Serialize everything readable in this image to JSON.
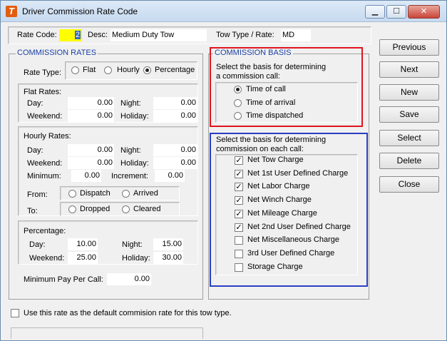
{
  "window": {
    "title": "Driver Commission Rate Code"
  },
  "header": {
    "rate_code_label": "Rate Code:",
    "rate_code_value": "2",
    "desc_label": "Desc:",
    "desc_value": "Medium Duty Tow",
    "tow_type_label": "Tow Type / Rate:",
    "tow_type_value": "MD"
  },
  "commission_rates": {
    "title": "COMMISSION RATES",
    "rate_type_label": "Rate Type:",
    "rate_type_options": [
      "Flat",
      "Hourly",
      "Percentage"
    ],
    "rate_type_selected": "Percentage",
    "flat": {
      "title": "Flat Rates:",
      "day_label": "Day:",
      "day": "0.00",
      "night_label": "Night:",
      "night": "0.00",
      "weekend_label": "Weekend:",
      "weekend": "0.00",
      "holiday_label": "Holiday:",
      "holiday": "0.00"
    },
    "hourly": {
      "title": "Hourly Rates:",
      "day_label": "Day:",
      "day": "0.00",
      "night_label": "Night:",
      "night": "0.00",
      "weekend_label": "Weekend:",
      "weekend": "0.00",
      "holiday_label": "Holiday:",
      "holiday": "0.00",
      "minimum_label": "Minimum:",
      "minimum": "0.00",
      "increment_label": "Increment:",
      "increment": "0.00",
      "from_label": "From:",
      "from_options": [
        "Dispatch",
        "Arrived"
      ],
      "to_label": "To:",
      "to_options": [
        "Dropped",
        "Cleared"
      ]
    },
    "percentage": {
      "title": "Percentage:",
      "day_label": "Day:",
      "day": "10.00",
      "night_label": "Night:",
      "night": "15.00",
      "weekend_label": "Weekend:",
      "weekend": "25.00",
      "holiday_label": "Holiday:",
      "holiday": "30.00"
    },
    "min_pay_label": "Minimum Pay Per Call:",
    "min_pay_value": "0.00"
  },
  "commission_basis": {
    "title": "COMMISSION BASIS",
    "basis_prompt_line1": "Select the basis for determining",
    "basis_prompt_line2": "a commission call:",
    "basis_options": [
      "Time of call",
      "Time of arrival",
      "Time dispatched"
    ],
    "basis_selected": "Time of call",
    "charges_prompt_line1": "Select the basis for determining",
    "charges_prompt_line2": "commission on each call:",
    "charges": [
      {
        "label": "Net Tow Charge",
        "checked": true
      },
      {
        "label": "Net 1st User Defined Charge",
        "checked": true
      },
      {
        "label": "Net Labor Charge",
        "checked": true
      },
      {
        "label": "Net Winch Charge",
        "checked": true
      },
      {
        "label": "Net Mileage Charge",
        "checked": true
      },
      {
        "label": "Net 2nd User Defined Charge",
        "checked": true
      },
      {
        "label": "Net Miscellaneous Charge",
        "checked": false
      },
      {
        "label": "3rd User Defined Charge",
        "checked": false
      },
      {
        "label": "Storage Charge",
        "checked": false
      }
    ]
  },
  "buttons": {
    "previous": "Previous",
    "next": "Next",
    "new": "New",
    "save": "Save",
    "select": "Select",
    "delete": "Delete",
    "close": "Close"
  },
  "footer": {
    "default_checkbox_label": "Use this rate as the default commision rate for this tow type."
  },
  "colors": {
    "highlight_box": "#e0141e",
    "charges_box": "#2a3fc4",
    "group_title": "#1a3fa3",
    "rate_code_bg": "#ffff00"
  },
  "icons": {
    "app": "app-logo-icon",
    "check": "check-icon"
  }
}
